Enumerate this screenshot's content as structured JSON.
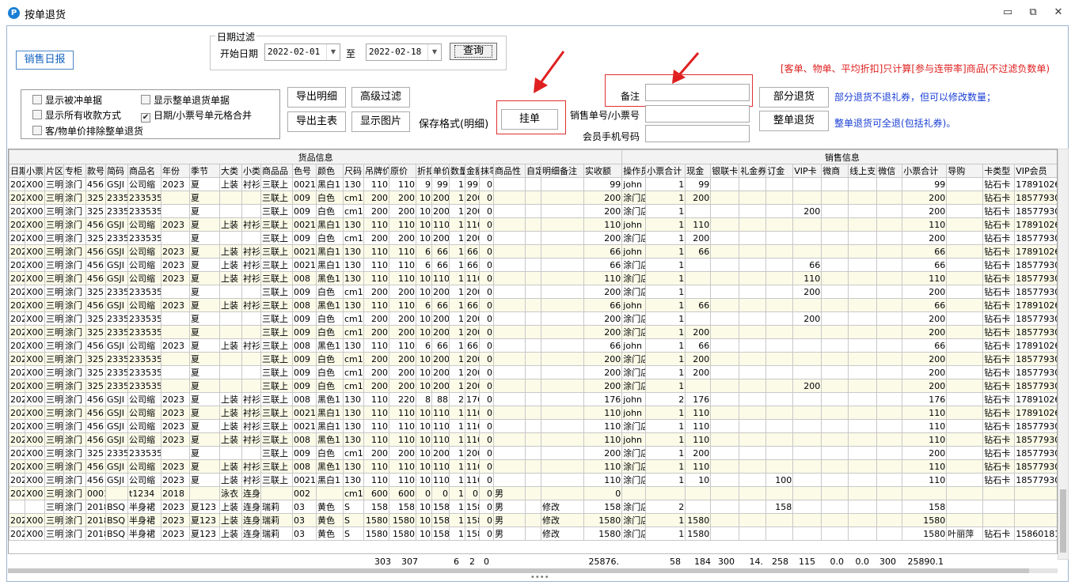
{
  "window": {
    "title": "按单退货",
    "minimize": "▭",
    "restore": "⧉",
    "close": "✕"
  },
  "buttons": {
    "sales_report": "销售日报",
    "query": "查询",
    "export_detail": "导出明细",
    "advanced_filter": "高级过滤",
    "export_master": "导出主表",
    "show_image": "显示图片",
    "save_format": "保存格式(明细)",
    "hang": "挂单",
    "partial_return": "部分退货",
    "full_return": "整单退货"
  },
  "date_filter": {
    "group_title": "日期过滤",
    "start_label": "开始日期",
    "start_value": "2022-02-01",
    "to_label": "至",
    "end_value": "2022-02-18"
  },
  "notes": {
    "red": "[客单、物单、平均折扣]只计算[参与连带率]商品(不过滤负数单)",
    "partial": "部分退货不退礼券，但可以修改数量；",
    "full": "整单退货可全退(包括礼券)。"
  },
  "options": [
    {
      "label": "显示被冲单据",
      "checked": false
    },
    {
      "label": "显示整单退货单据",
      "checked": false
    },
    {
      "label": "显示所有收款方式",
      "checked": false
    },
    {
      "label": "日期/小票号单元格合并",
      "checked": true
    },
    {
      "label": "客/物单价排除整单退货",
      "checked": false
    }
  ],
  "fields": {
    "remark_label": "备注",
    "remark_value": "",
    "order_label": "销售单号/小票号",
    "order_value": "",
    "phone_label": "会员手机号码",
    "phone_value": ""
  },
  "grid": {
    "group_left": "货品信息",
    "group_right": "销售信息",
    "columns": [
      "日期",
      "小票",
      "片区",
      "专柜",
      "款号",
      "简码",
      "商品名",
      "年份",
      "季节",
      "大类",
      "小类",
      "商品品",
      "色号",
      "颜色",
      "尺码",
      "吊牌价",
      "原价",
      "折扣",
      "单价",
      "数量",
      "金额",
      "抹零",
      "商品性",
      "自定",
      "明细备注",
      "实收额",
      "操作员",
      "小票合计",
      "现金",
      "银联卡",
      "礼金券",
      "订金",
      "VIP卡",
      "微商",
      "线上支付",
      "微信",
      "小票合计",
      "导购",
      "卡类型",
      "VIP会员"
    ],
    "rows": [
      [
        "202",
        "X00",
        "三明",
        "涂门",
        "456",
        "GSJI",
        "公司缩",
        "2023",
        "夏",
        "上装",
        "衬衫",
        "三联上",
        "0021",
        "黑白1",
        "130",
        "110",
        "110",
        "9",
        "99",
        "1",
        "99",
        "0",
        "",
        "",
        "",
        "99",
        "john",
        "1",
        "99",
        "",
        "",
        "",
        "",
        "",
        "",
        "",
        "99",
        "",
        "钻石卡",
        "1789102695"
      ],
      [
        "202",
        "X00",
        "三明",
        "涂门",
        "325",
        "2335",
        "233535",
        "",
        "夏",
        "",
        "",
        "三联上",
        "009",
        "白色",
        "cm1",
        "200",
        "200",
        "10",
        "200",
        "1",
        "200",
        "0",
        "",
        "",
        "",
        "200",
        "涂门店",
        "1",
        "200",
        "",
        "",
        "",
        "",
        "",
        "",
        "",
        "200",
        "",
        "钻石卡",
        "1857793081"
      ],
      [
        "202",
        "X00",
        "三明",
        "涂门",
        "325",
        "2335",
        "233535",
        "",
        "夏",
        "",
        "",
        "三联上",
        "009",
        "白色",
        "cm1",
        "200",
        "200",
        "10",
        "200",
        "1",
        "200",
        "0",
        "",
        "",
        "",
        "200",
        "涂门店",
        "1",
        "",
        "",
        "",
        "",
        "200",
        "",
        "",
        "",
        "200",
        "",
        "钻石卡",
        "1857793081"
      ],
      [
        "202",
        "X00",
        "三明",
        "涂门",
        "456",
        "GSJI",
        "公司缩",
        "2023",
        "夏",
        "上装",
        "衬衫",
        "三联上",
        "0021",
        "黑白1",
        "130",
        "110",
        "110",
        "10",
        "110",
        "1",
        "110",
        "0",
        "",
        "",
        "",
        "110",
        "john",
        "1",
        "110",
        "",
        "",
        "",
        "",
        "",
        "",
        "",
        "110",
        "",
        "钻石卡",
        "1789102695"
      ],
      [
        "202",
        "X00",
        "三明",
        "涂门",
        "325",
        "2335",
        "233535",
        "",
        "夏",
        "",
        "",
        "三联上",
        "009",
        "白色",
        "cm1",
        "200",
        "200",
        "10",
        "200",
        "1",
        "200",
        "0",
        "",
        "",
        "",
        "200",
        "涂门店",
        "1",
        "200",
        "",
        "",
        "",
        "",
        "",
        "",
        "",
        "200",
        "",
        "钻石卡",
        "1857793081"
      ],
      [
        "202",
        "X00",
        "三明",
        "涂门",
        "456",
        "GSJI",
        "公司缩",
        "2023",
        "夏",
        "上装",
        "衬衫",
        "三联上",
        "0021",
        "黑白1",
        "130",
        "110",
        "110",
        "6",
        "66",
        "1",
        "66",
        "0",
        "",
        "",
        "",
        "66",
        "john",
        "1",
        "66",
        "",
        "",
        "",
        "",
        "",
        "",
        "",
        "66",
        "",
        "钻石卡",
        "1789102695"
      ],
      [
        "202",
        "X00",
        "三明",
        "涂门",
        "456",
        "GSJI",
        "公司缩",
        "2023",
        "夏",
        "上装",
        "衬衫",
        "三联上",
        "0021",
        "黑白1",
        "130",
        "110",
        "110",
        "6",
        "66",
        "1",
        "66",
        "0",
        "",
        "",
        "",
        "66",
        "涂门店",
        "1",
        "",
        "",
        "",
        "",
        "66",
        "",
        "",
        "",
        "66",
        "",
        "钻石卡",
        "1857793081"
      ],
      [
        "202",
        "X00",
        "三明",
        "涂门",
        "456",
        "GSJI",
        "公司缩",
        "2023",
        "夏",
        "上装",
        "衬衫",
        "三联上",
        "008",
        "黑色1",
        "130",
        "110",
        "110",
        "10",
        "110",
        "1",
        "110",
        "0",
        "",
        "",
        "",
        "110",
        "涂门店",
        "1",
        "",
        "",
        "",
        "",
        "110",
        "",
        "",
        "",
        "110",
        "",
        "钻石卡",
        "1857793081"
      ],
      [
        "202",
        "X00",
        "三明",
        "涂门",
        "325",
        "2335",
        "233535",
        "",
        "夏",
        "",
        "",
        "三联上",
        "009",
        "白色",
        "cm1",
        "200",
        "200",
        "10",
        "200",
        "1",
        "200",
        "0",
        "",
        "",
        "",
        "200",
        "涂门店",
        "1",
        "",
        "",
        "",
        "",
        "200",
        "",
        "",
        "",
        "200",
        "",
        "钻石卡",
        "1857793081"
      ],
      [
        "202",
        "X00",
        "三明",
        "涂门",
        "456",
        "GSJI",
        "公司缩",
        "2023",
        "夏",
        "上装",
        "衬衫",
        "三联上",
        "008",
        "黑色1",
        "130",
        "110",
        "110",
        "6",
        "66",
        "1",
        "66",
        "0",
        "",
        "",
        "",
        "66",
        "john",
        "1",
        "66",
        "",
        "",
        "",
        "",
        "",
        "",
        "",
        "66",
        "",
        "钻石卡",
        "1789102695"
      ],
      [
        "202",
        "X00",
        "三明",
        "涂门",
        "325",
        "2335",
        "233535",
        "",
        "夏",
        "",
        "",
        "三联上",
        "009",
        "白色",
        "cm1",
        "200",
        "200",
        "10",
        "200",
        "1",
        "200",
        "0",
        "",
        "",
        "",
        "200",
        "涂门店",
        "1",
        "",
        "",
        "",
        "",
        "200",
        "",
        "",
        "",
        "200",
        "",
        "钻石卡",
        "1857793081"
      ],
      [
        "202",
        "X00",
        "三明",
        "涂门",
        "325",
        "2335",
        "233535",
        "",
        "夏",
        "",
        "",
        "三联上",
        "009",
        "白色",
        "cm1",
        "200",
        "200",
        "10",
        "200",
        "1",
        "200",
        "0",
        "",
        "",
        "",
        "200",
        "涂门店",
        "1",
        "200",
        "",
        "",
        "",
        "",
        "",
        "",
        "",
        "200",
        "",
        "钻石卡",
        "1857793081"
      ],
      [
        "202",
        "X00",
        "三明",
        "涂门",
        "456",
        "GSJI",
        "公司缩",
        "2023",
        "夏",
        "上装",
        "衬衫",
        "三联上",
        "008",
        "黑色1",
        "130",
        "110",
        "110",
        "6",
        "66",
        "1",
        "66",
        "0",
        "",
        "",
        "",
        "66",
        "john",
        "1",
        "66",
        "",
        "",
        "",
        "",
        "",
        "",
        "",
        "66",
        "",
        "钻石卡",
        "1789102695"
      ],
      [
        "202",
        "X00",
        "三明",
        "涂门",
        "325",
        "2335",
        "233535",
        "",
        "夏",
        "",
        "",
        "三联上",
        "009",
        "白色",
        "cm1",
        "200",
        "200",
        "10",
        "200",
        "1",
        "200",
        "0",
        "",
        "",
        "",
        "200",
        "涂门店",
        "1",
        "200",
        "",
        "",
        "",
        "",
        "",
        "",
        "",
        "200",
        "",
        "钻石卡",
        "1857793081"
      ],
      [
        "202",
        "X00",
        "三明",
        "涂门",
        "325",
        "2335",
        "233535",
        "",
        "夏",
        "",
        "",
        "三联上",
        "009",
        "白色",
        "cm1",
        "200",
        "200",
        "10",
        "200",
        "1",
        "200",
        "0",
        "",
        "",
        "",
        "200",
        "涂门店",
        "1",
        "200",
        "",
        "",
        "",
        "",
        "",
        "",
        "",
        "200",
        "",
        "钻石卡",
        "1857793081"
      ],
      [
        "202",
        "X00",
        "三明",
        "涂门",
        "325",
        "2335",
        "233535",
        "",
        "夏",
        "",
        "",
        "三联上",
        "009",
        "白色",
        "cm1",
        "200",
        "200",
        "10",
        "200",
        "1",
        "200",
        "0",
        "",
        "",
        "",
        "200",
        "涂门店",
        "1",
        "",
        "",
        "",
        "",
        "200",
        "",
        "",
        "",
        "200",
        "",
        "钻石卡",
        "1857793081"
      ],
      [
        "202",
        "X00",
        "三明",
        "涂门",
        "456",
        "GSJI",
        "公司缩",
        "2023",
        "夏",
        "上装",
        "衬衫",
        "三联上",
        "008",
        "黑色1",
        "130",
        "110",
        "220",
        "8",
        "88",
        "2",
        "176",
        "0",
        "",
        "",
        "",
        "176",
        "john",
        "2",
        "176",
        "",
        "",
        "",
        "",
        "",
        "",
        "",
        "176",
        "",
        "钻石卡",
        "1789102695"
      ],
      [
        "202",
        "X00",
        "三明",
        "涂门",
        "456",
        "GSJI",
        "公司缩",
        "2023",
        "夏",
        "上装",
        "衬衫",
        "三联上",
        "0021",
        "黑白1",
        "130",
        "110",
        "110",
        "10",
        "110",
        "1",
        "110",
        "0",
        "",
        "",
        "",
        "110",
        "john",
        "1",
        "110",
        "",
        "",
        "",
        "",
        "",
        "",
        "",
        "110",
        "",
        "钻石卡",
        "1789102695"
      ],
      [
        "202",
        "X00",
        "三明",
        "涂门",
        "456",
        "GSJI",
        "公司缩",
        "2023",
        "夏",
        "上装",
        "衬衫",
        "三联上",
        "0021",
        "黑白1",
        "130",
        "110",
        "110",
        "10",
        "110",
        "1",
        "110",
        "0",
        "",
        "",
        "",
        "110",
        "涂门店",
        "1",
        "110",
        "",
        "",
        "",
        "",
        "",
        "",
        "",
        "110",
        "",
        "钻石卡",
        "1857793081"
      ],
      [
        "202",
        "X00",
        "三明",
        "涂门",
        "456",
        "GSJI",
        "公司缩",
        "2023",
        "夏",
        "上装",
        "衬衫",
        "三联上",
        "008",
        "黑色1",
        "130",
        "110",
        "110",
        "10",
        "110",
        "1",
        "110",
        "0",
        "",
        "",
        "",
        "110",
        "john",
        "1",
        "110",
        "",
        "",
        "",
        "",
        "",
        "",
        "",
        "110",
        "",
        "钻石卡",
        "1857793081"
      ],
      [
        "202",
        "X00",
        "三明",
        "涂门",
        "325",
        "2335",
        "233535",
        "",
        "夏",
        "",
        "",
        "三联上",
        "009",
        "白色",
        "cm1",
        "200",
        "200",
        "10",
        "200",
        "1",
        "200",
        "0",
        "",
        "",
        "",
        "200",
        "涂门店",
        "1",
        "200",
        "",
        "",
        "",
        "",
        "",
        "",
        "",
        "200",
        "",
        "钻石卡",
        "1857793081"
      ],
      [
        "202",
        "X00",
        "三明",
        "涂门",
        "456",
        "GSJI",
        "公司缩",
        "2023",
        "夏",
        "上装",
        "衬衫",
        "三联上",
        "008",
        "黑色1",
        "130",
        "110",
        "110",
        "10",
        "110",
        "1",
        "110",
        "0",
        "",
        "",
        "",
        "110",
        "涂门店",
        "1",
        "110",
        "",
        "",
        "",
        "",
        "",
        "",
        "",
        "110",
        "",
        "钻石卡",
        "1857793081"
      ],
      [
        "202",
        "X00",
        "三明",
        "涂门",
        "456",
        "GSJI",
        "公司缩",
        "2023",
        "夏",
        "上装",
        "衬衫",
        "三联上",
        "0021",
        "黑白1",
        "130",
        "110",
        "110",
        "10",
        "110",
        "1",
        "110",
        "0",
        "",
        "",
        "",
        "110",
        "涂门店",
        "1",
        "10",
        "",
        "",
        "100",
        "",
        "",
        "",
        "",
        "110",
        "",
        "钻石卡",
        "1857793081"
      ],
      [
        "202",
        "X00",
        "三明",
        "涂门",
        "0001",
        "",
        "t1234",
        "2018",
        "",
        "泳衣",
        "连身",
        "",
        "002",
        "",
        "cm1",
        "600",
        "600",
        "0",
        "0",
        "1",
        "0",
        "0",
        "男",
        "",
        "",
        "0",
        "",
        "",
        "",
        "",
        "",
        "",
        "",
        "",
        "",
        "",
        "",
        "",
        "",
        ""
      ],
      [
        "",
        "",
        "三明",
        "涂门",
        "2018",
        "BSQ",
        "半身裙",
        "2023",
        "夏123",
        "上装",
        "连身",
        "瑞莉",
        "03",
        "黄色",
        "S",
        "158",
        "158",
        "10",
        "158",
        "1",
        "158",
        "0",
        "男",
        "",
        "修改",
        "158",
        "涂门店",
        "2",
        "",
        "",
        "",
        "158",
        "",
        "",
        "",
        "",
        "158",
        "",
        "",
        ""
      ],
      [
        "202",
        "X00",
        "三明",
        "涂门",
        "2018",
        "BSQ",
        "半身裙",
        "2023",
        "夏123",
        "上装",
        "连身",
        "瑞莉",
        "03",
        "黄色",
        "S",
        "1580",
        "1580",
        "10",
        "158",
        "1",
        "158",
        "0",
        "男",
        "",
        "修改",
        "1580",
        "涂门店",
        "1",
        "1580",
        "",
        "",
        "",
        "",
        "",
        "",
        "",
        "1580",
        "",
        "",
        ""
      ],
      [
        "202",
        "X00",
        "三明",
        "涂门",
        "2018",
        "BSQ",
        "半身裙",
        "2023",
        "夏123",
        "上装",
        "连身",
        "瑞莉",
        "03",
        "黄色",
        "S",
        "1580",
        "1580",
        "10",
        "158",
        "1",
        "158",
        "0",
        "男",
        "",
        "修改",
        "1580",
        "涂门店",
        "1",
        "1580",
        "",
        "",
        "",
        "",
        "",
        "",
        "",
        "1580",
        "叶丽萍",
        "钻石卡",
        "1586018152"
      ]
    ]
  },
  "totals": [
    "303",
    "307",
    "6",
    "2",
    "0",
    "25876.",
    "58",
    "184",
    "300",
    "14.",
    "258",
    "115",
    "0.0",
    "0.0",
    "300",
    "25890.1"
  ]
}
